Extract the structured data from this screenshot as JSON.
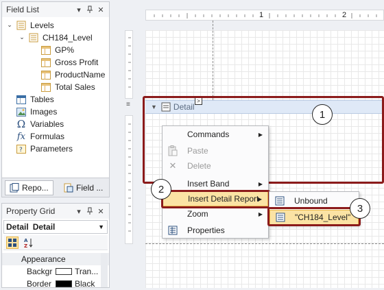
{
  "field_list": {
    "title": "Field List",
    "tree": {
      "root": "Levels",
      "level": "CH184_Level",
      "fields": [
        "GP%",
        "Gross Profit",
        "ProductName",
        "Total Sales"
      ],
      "others": [
        "Tables",
        "Images",
        "Variables",
        "Formulas",
        "Parameters"
      ]
    },
    "tabs": [
      "Repo...",
      "Field ..."
    ]
  },
  "property_grid": {
    "title": "Property Grid",
    "selected_object": "Detail",
    "selected_type": "Detail",
    "category": "Appearance",
    "rows": [
      {
        "name": "Backgr",
        "value": "Tran..."
      },
      {
        "name": "Border",
        "value": "Black"
      }
    ]
  },
  "ruler": {
    "marks": [
      "1",
      "2"
    ]
  },
  "band": {
    "label": "Detail",
    "expand_glyph": ">"
  },
  "context_menu": {
    "items": [
      {
        "label": "Commands",
        "submenu": true
      },
      {
        "label": "Paste",
        "disabled": true
      },
      {
        "label": "Delete",
        "disabled": true
      },
      {
        "label": "Insert Band",
        "submenu": true
      },
      {
        "label": "Insert Detail Report",
        "submenu": true
      },
      {
        "label": "Zoom",
        "submenu": true
      },
      {
        "label": "Properties"
      }
    ]
  },
  "submenu": {
    "items": [
      "Unbound",
      "\"CH184_Level\""
    ]
  },
  "callouts": [
    "1",
    "2",
    "3"
  ],
  "colors": {
    "highlight": "#8b1a1a",
    "hover": "#fbe3a4",
    "band": "#dfe9f7"
  }
}
